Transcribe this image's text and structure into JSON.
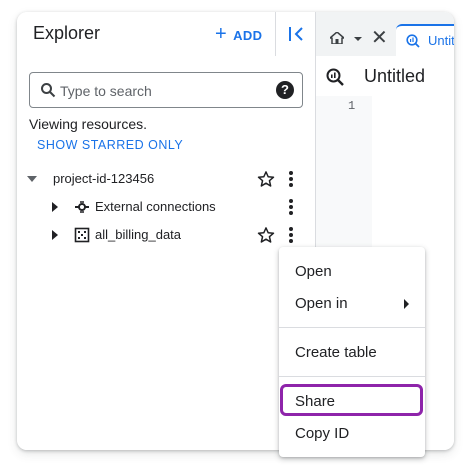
{
  "explorer": {
    "title": "Explorer",
    "add_label": "ADD",
    "search_placeholder": "Type to search",
    "viewing_text": "Viewing resources.",
    "starred_label": "SHOW STARRED ONLY",
    "tree": {
      "project": {
        "label": "project-id-123456",
        "expanded": true,
        "starred": false
      },
      "children": [
        {
          "label": "External connections",
          "icon": "connection-icon",
          "starred": false
        },
        {
          "label": "all_billing_data",
          "icon": "dataset-icon",
          "starred": false
        }
      ]
    }
  },
  "editor": {
    "tab_label": "Untitled",
    "query_title": "Untitled",
    "line_numbers": [
      "1"
    ]
  },
  "context_menu": {
    "items": [
      {
        "label": "Open"
      },
      {
        "label": "Open in",
        "has_submenu": true
      },
      {
        "label": "Create table"
      },
      {
        "label": "Share",
        "highlighted": true
      },
      {
        "label": "Copy ID"
      }
    ]
  },
  "colors": {
    "accent": "#1a73e8",
    "highlight": "#8e24aa",
    "text": "#202124",
    "border": "#dadce0"
  }
}
